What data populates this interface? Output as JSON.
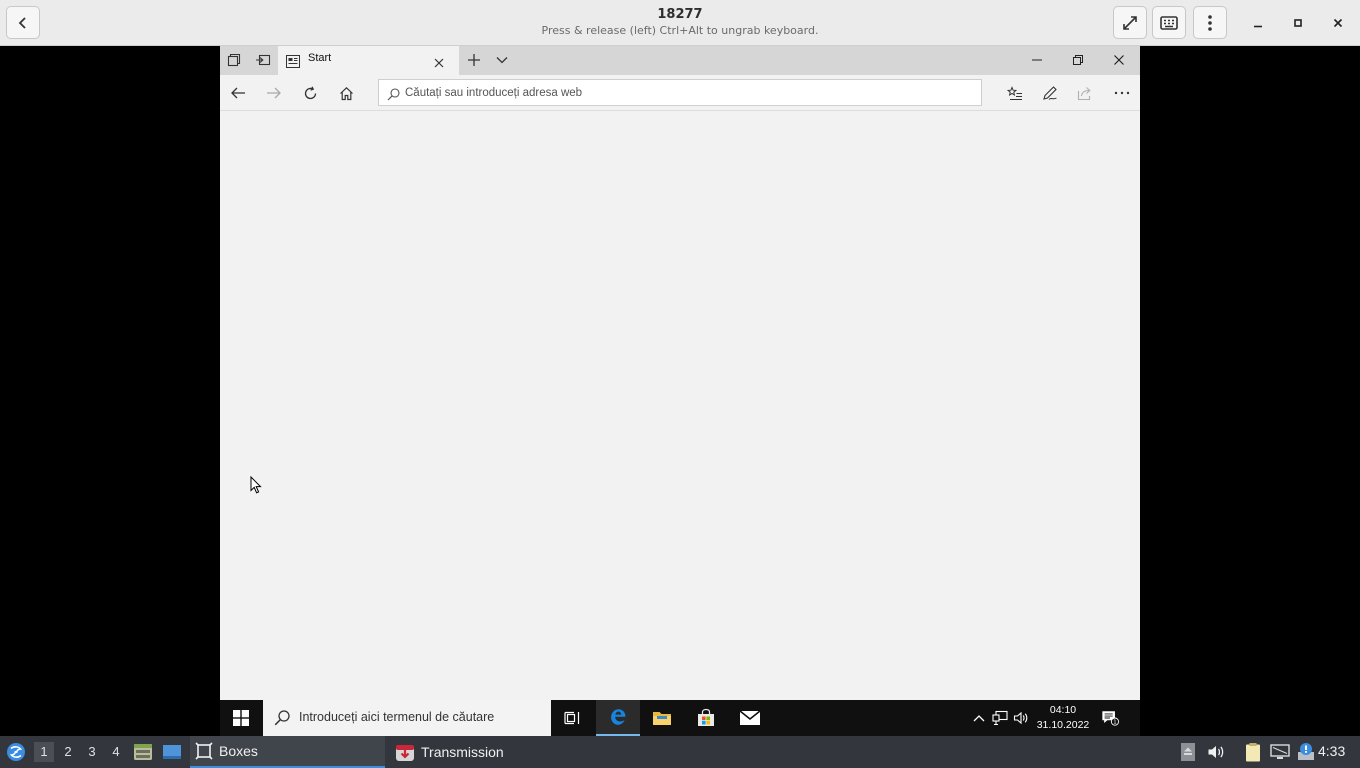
{
  "boxes_header": {
    "title": "18277",
    "subtitle": "Press & release (left) Ctrl+Alt to ungrab keyboard."
  },
  "browser": {
    "tab_title": "Start",
    "address_placeholder": "Căutați sau introduceți adresa web"
  },
  "win_taskbar": {
    "search_placeholder": "Introduceți aici termenul de căutare",
    "time": "04:10",
    "date": "31.10.2022"
  },
  "panel": {
    "workspaces": [
      "1",
      "2",
      "3",
      "4"
    ],
    "tasks": [
      {
        "label": "Boxes"
      },
      {
        "label": "Transmission"
      }
    ],
    "time": "4:33"
  },
  "colors": {
    "edge_blue": "#0078d7",
    "panel_bg": "#33373d",
    "active_task_underline": "#3d8ee0"
  }
}
